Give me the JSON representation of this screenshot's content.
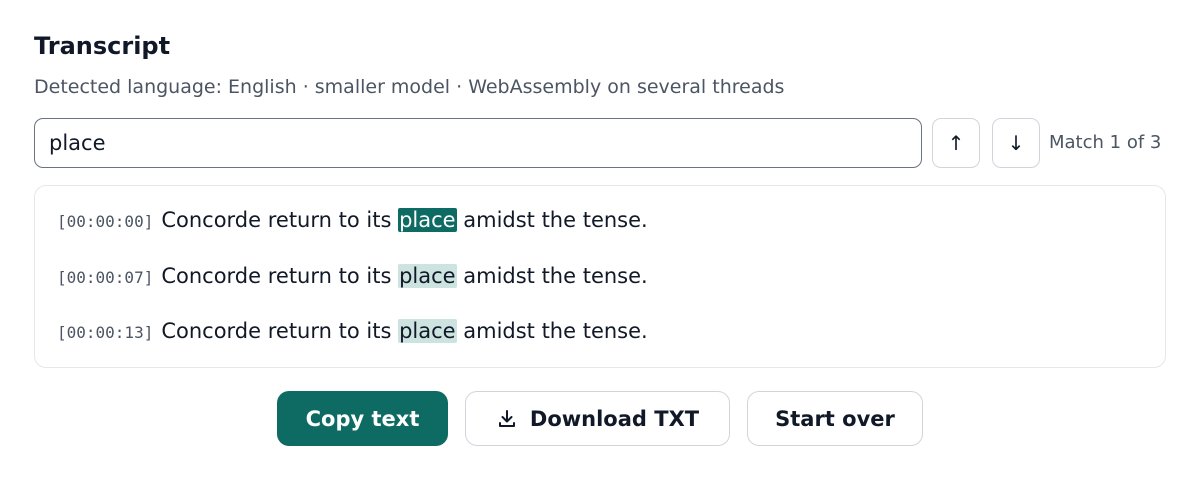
{
  "header": {
    "title": "Transcript",
    "subtitle": "Detected language: English · smaller model · WebAssembly on several threads"
  },
  "search": {
    "value": "place",
    "prev_icon": "arrow-up-icon",
    "next_icon": "arrow-down-icon",
    "prev_glyph": "↑",
    "next_glyph": "↓",
    "match_status": "Match 1 of 3"
  },
  "segments": [
    {
      "timestamp": "[00:00:00]",
      "before": "Concorde return to its ",
      "match": "place",
      "after": " amidst the tense.",
      "active": true
    },
    {
      "timestamp": "[00:00:07]",
      "before": "Concorde return to its ",
      "match": "place",
      "after": " amidst the tense.",
      "active": false
    },
    {
      "timestamp": "[00:00:13]",
      "before": "Concorde return to its ",
      "match": "place",
      "after": " amidst the tense.",
      "active": false
    }
  ],
  "actions": {
    "copy_label": "Copy text",
    "download_label": "Download TXT",
    "download_icon": "download-icon",
    "start_over_label": "Start over"
  },
  "colors": {
    "accent": "#0e6b63",
    "match_highlight": "#cce3e0",
    "text": "#111827",
    "muted": "#4b5563"
  }
}
